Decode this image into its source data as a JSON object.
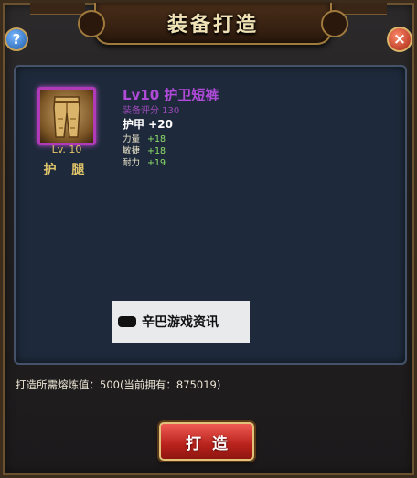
{
  "dialog": {
    "title": "装备打造",
    "help_label": "?",
    "close_label": "×"
  },
  "item": {
    "icon": "golden-pants-icon",
    "level_label": "Lv. 10",
    "type": "护 腿",
    "name": "Lv10 护卫短裤",
    "score": "装备评分 130",
    "armor": "护甲  +20",
    "stats": [
      {
        "name": "力量",
        "value": "+18"
      },
      {
        "name": "敏捷",
        "value": "+18"
      },
      {
        "name": "耐力",
        "value": "+19"
      }
    ]
  },
  "watermark": {
    "text": "辛巴游戏资讯"
  },
  "cost": {
    "text": "打造所需熔炼值：500(当前拥有：875019)"
  },
  "actions": {
    "forge_label": "打造"
  },
  "colors": {
    "rarity_border": "#b03ab8",
    "item_name": "#b04ad8",
    "stat_value": "#8fe06a",
    "button": "#c8281f"
  }
}
